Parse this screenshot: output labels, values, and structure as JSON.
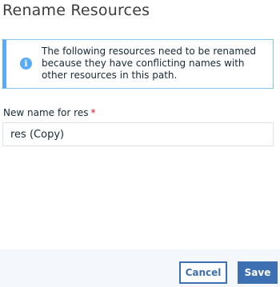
{
  "dialog": {
    "title": "Rename Resources"
  },
  "notice": {
    "icon": "info-icon",
    "icon_glyph": "i",
    "message": "The following resources need to be renamed because they have conflicting names with other resources in this path.",
    "accent_color": "#5aaafa"
  },
  "form": {
    "label": "New name for res",
    "required_marker": "*",
    "value": "res (Copy)"
  },
  "actions": {
    "cancel_label": "Cancel",
    "save_label": "Save",
    "primary_color": "#3d70b2"
  }
}
